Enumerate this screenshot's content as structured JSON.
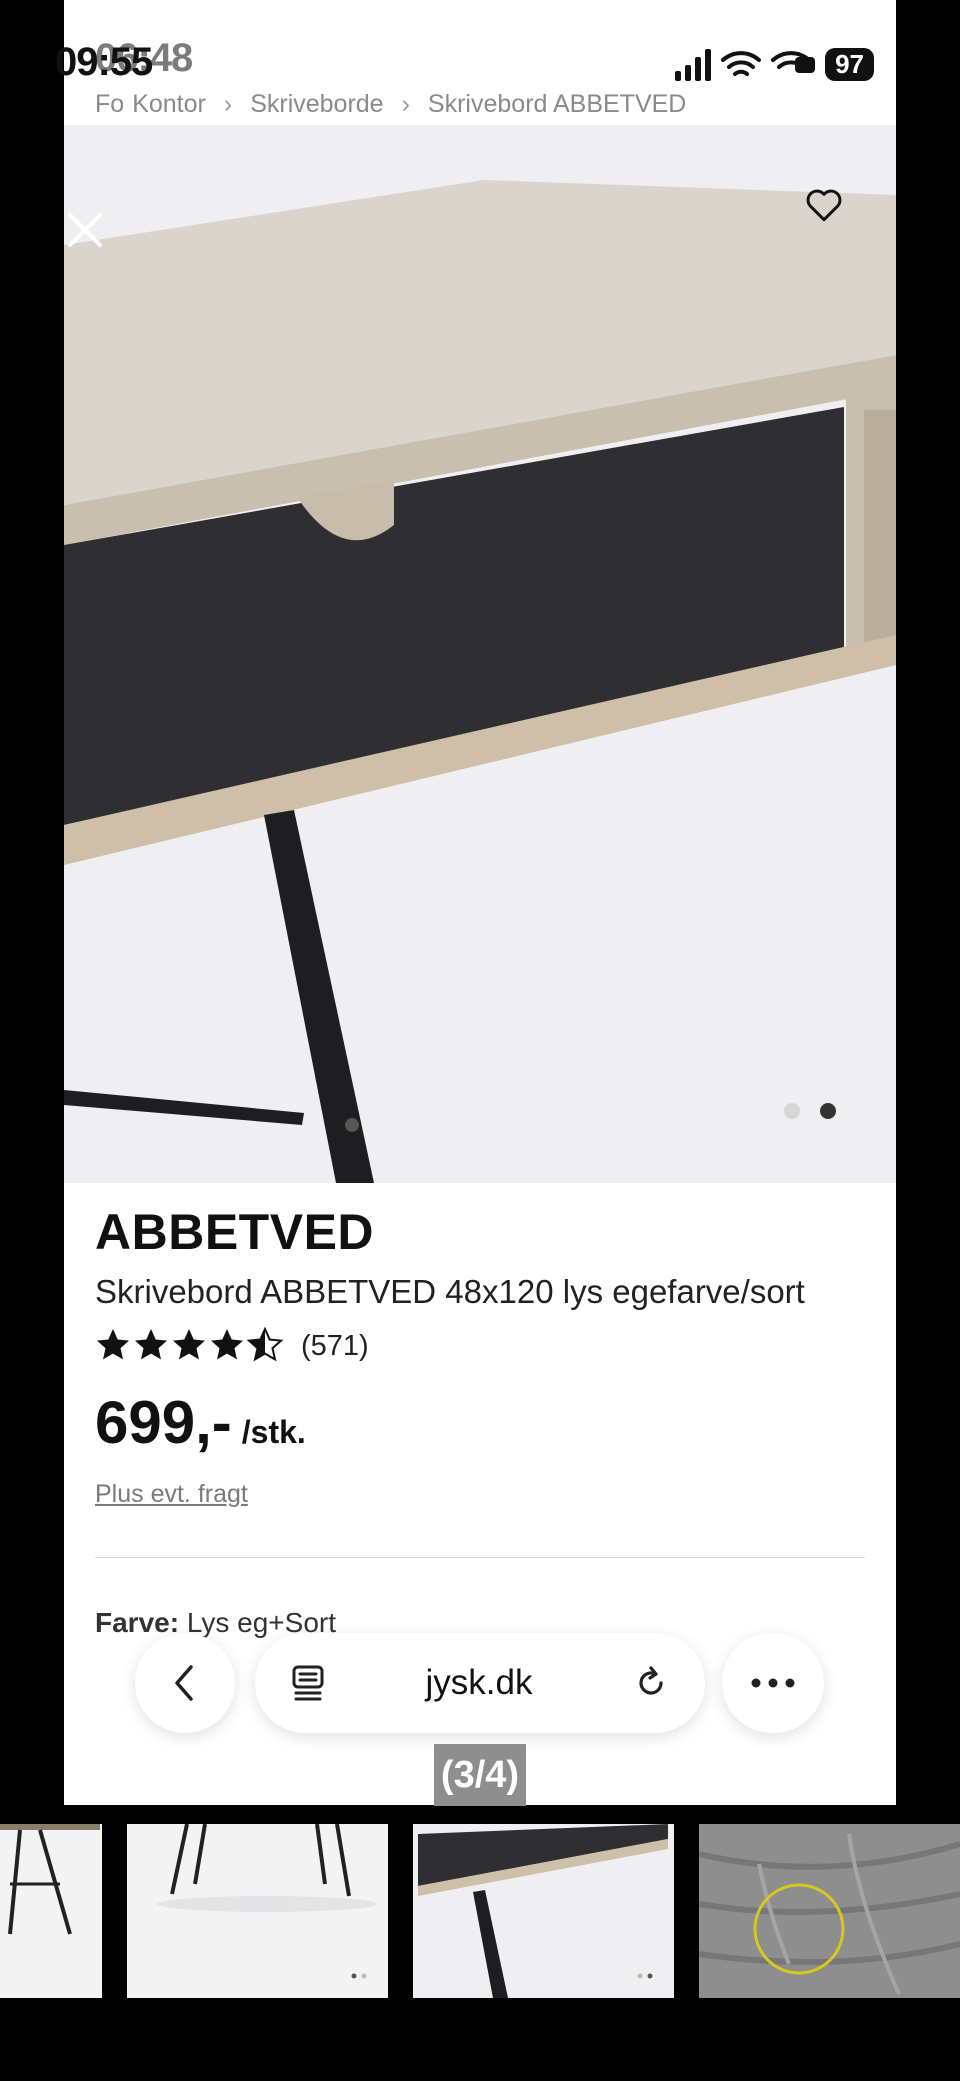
{
  "status_bar": {
    "time": "09:55",
    "time_overlay": "06:48",
    "battery": "97"
  },
  "breadcrumb": {
    "items": [
      "Fo",
      "Kontor",
      "Skriveborde",
      "Skrivebord ABBETVED"
    ]
  },
  "product": {
    "brand": "ABBETVED",
    "title": "Skrivebord ABBETVED 48x120 lys egefarve/sort",
    "rating": 4.5,
    "review_count": "(571)",
    "price": "699,-",
    "price_unit": "/stk.",
    "freight_link": "Plus evt. fragt",
    "color_label": "Farve:",
    "color_value": "Lys eg+Sort"
  },
  "carousel": {
    "total_dots": 2,
    "active_dot": 2
  },
  "browser": {
    "url": "jysk.dk"
  },
  "gallery": {
    "counter": "(3/4)",
    "active_index": 3
  }
}
